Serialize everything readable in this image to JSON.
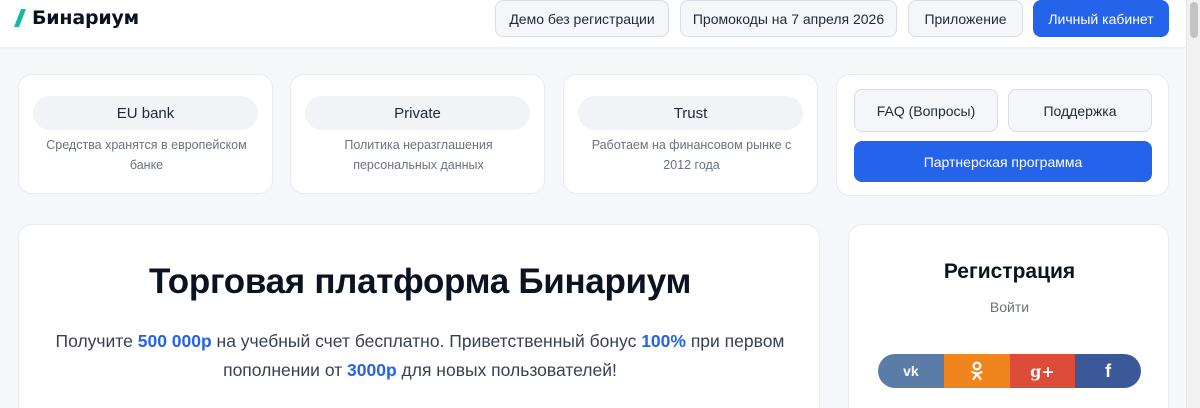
{
  "header": {
    "logo_text": "Бинариум",
    "logo_color": "#14b8a6",
    "nav": {
      "demo": "Демо без регистрации",
      "promo": "Промокоды на 7 апреля 2026",
      "app": "Приложение",
      "cabinet": "Личный кабинет"
    }
  },
  "features": [
    {
      "title": "EU bank",
      "description": "Средства хранятся в европейском банке"
    },
    {
      "title": "Private",
      "description": "Политика неразглашения персональных данных"
    },
    {
      "title": "Trust",
      "description": "Работаем на финансовом рынке с 2012 года"
    }
  ],
  "links": {
    "faq": "FAQ (Вопросы)",
    "support": "Поддержка",
    "partner": "Партнерская программа"
  },
  "hero": {
    "title": "Торговая платформа Бинариум",
    "text_1": "Получите ",
    "amount": "500 000р",
    "text_2": " на учебный счет бесплатно. Приветственный бонус ",
    "bonus": "100%",
    "text_3": " при первом пополнении от ",
    "min_deposit": "3000р",
    "text_4": " для новых пользователей!"
  },
  "registration": {
    "title": "Регистрация",
    "login": "Войти",
    "social": {
      "vk": "vk",
      "ok": "ok-icon",
      "gplus": "g+",
      "fb": "f"
    }
  },
  "colors": {
    "accent": "#2563eb",
    "vk": "#5a7ca6",
    "ok": "#f0851d",
    "gplus": "#dd4b39",
    "fb": "#3b5998"
  }
}
